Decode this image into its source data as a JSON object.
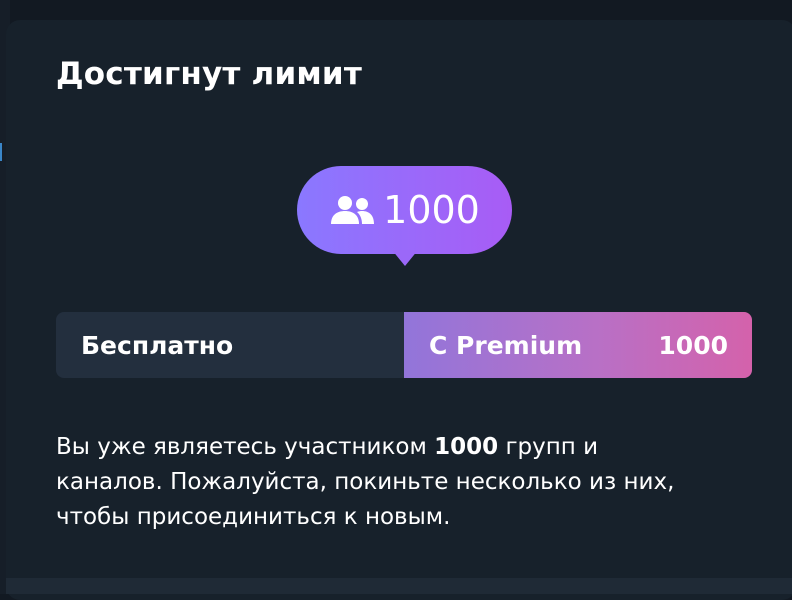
{
  "dialog": {
    "title": "Достигнут лимит",
    "badge": {
      "icon": "group-icon",
      "count": "1000"
    },
    "limit_bar": {
      "free_label": "Бесплатно",
      "premium_label": "С Premium",
      "premium_value": "1000"
    },
    "description": {
      "before": "Вы уже являетесь участником ",
      "count": "1000",
      "after": " групп и каналов. Пожалуйста, покиньте несколько из них, чтобы присоединиться к новым."
    }
  },
  "colors": {
    "background": "#17212b",
    "badge_gradient_start": "#8a78ff",
    "badge_gradient_end": "#a85cf5",
    "premium_gradient_start": "#9275da",
    "premium_gradient_end": "#d462ab",
    "free_segment": "#232f3e"
  }
}
